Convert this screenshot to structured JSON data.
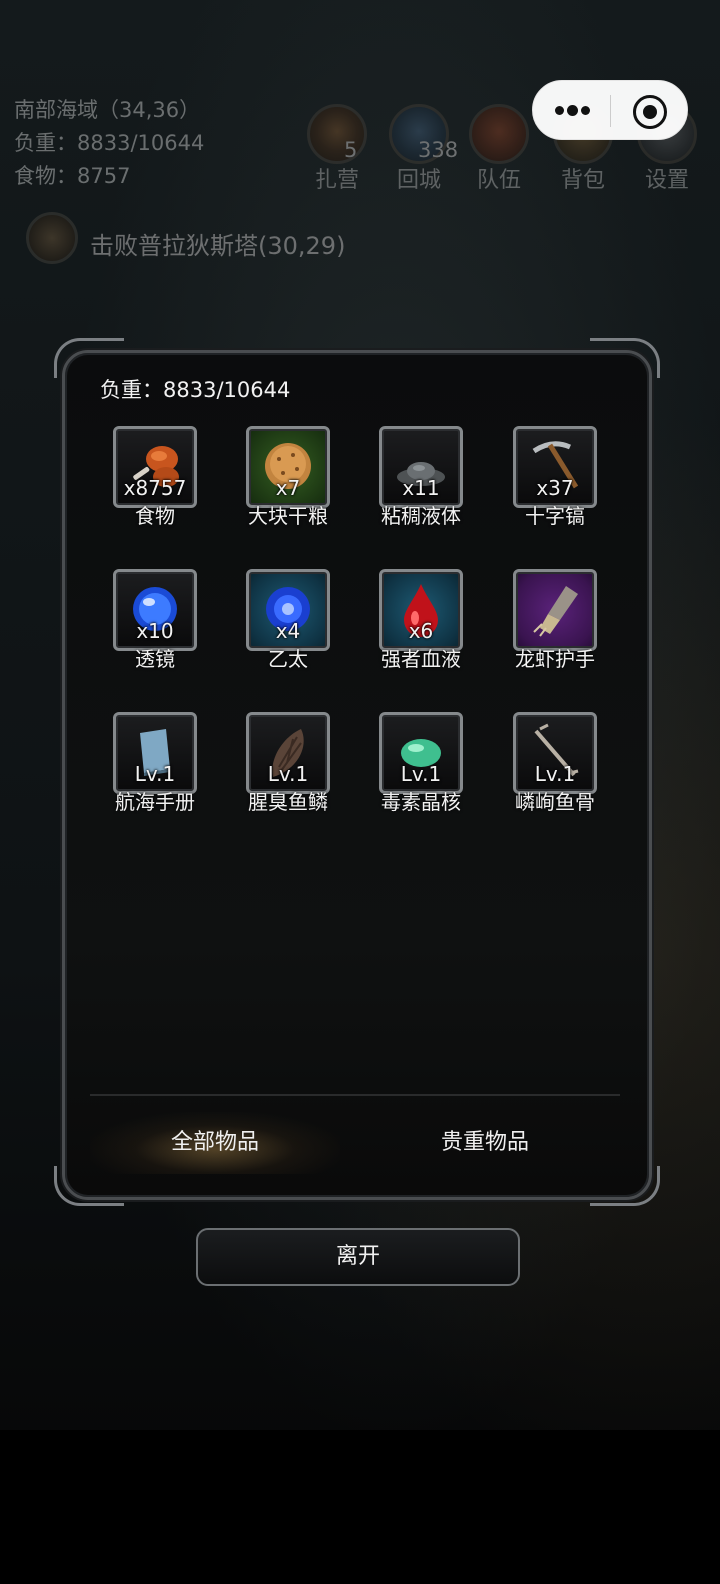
{
  "status": {
    "location": "南部海域（34,36）",
    "weight": "负重：8833/10644",
    "food": "食物：8757"
  },
  "hud": [
    {
      "label": "扎营",
      "count": "5"
    },
    {
      "label": "回城",
      "count": "338"
    },
    {
      "label": "队伍",
      "count": ""
    },
    {
      "label": "背包",
      "count": ""
    },
    {
      "label": "设置",
      "count": ""
    }
  ],
  "quest": {
    "text": "击败普拉狄斯塔(30,29)"
  },
  "inventory": {
    "weight": "负重：8833/10644",
    "items": [
      {
        "name": "食物",
        "count": "x8757",
        "icon": "roast-meat-icon"
      },
      {
        "name": "大块干粮",
        "count": "x7",
        "icon": "bread-icon"
      },
      {
        "name": "粘稠液体",
        "count": "x11",
        "icon": "goo-icon"
      },
      {
        "name": "十字镐",
        "count": "x37",
        "icon": "pickaxe-icon"
      },
      {
        "name": "透镜",
        "count": "x10",
        "icon": "lens-icon"
      },
      {
        "name": "乙太",
        "count": "x4",
        "icon": "ether-icon"
      },
      {
        "name": "强者血液",
        "count": "x6",
        "icon": "blood-drop-icon"
      },
      {
        "name": "龙虾护手",
        "count": "",
        "icon": "gauntlet-icon"
      },
      {
        "name": "航海手册",
        "count": "Lv.1",
        "icon": "book-icon"
      },
      {
        "name": "腥臭鱼鳞",
        "count": "Lv.1",
        "icon": "scale-icon"
      },
      {
        "name": "毒素晶核",
        "count": "Lv.1",
        "icon": "crystal-icon"
      },
      {
        "name": "嶙峋鱼骨",
        "count": "Lv.1",
        "icon": "fishbone-icon"
      }
    ]
  },
  "tabs": {
    "all": "全部物品",
    "valuable": "贵重物品"
  },
  "leave": "离开"
}
